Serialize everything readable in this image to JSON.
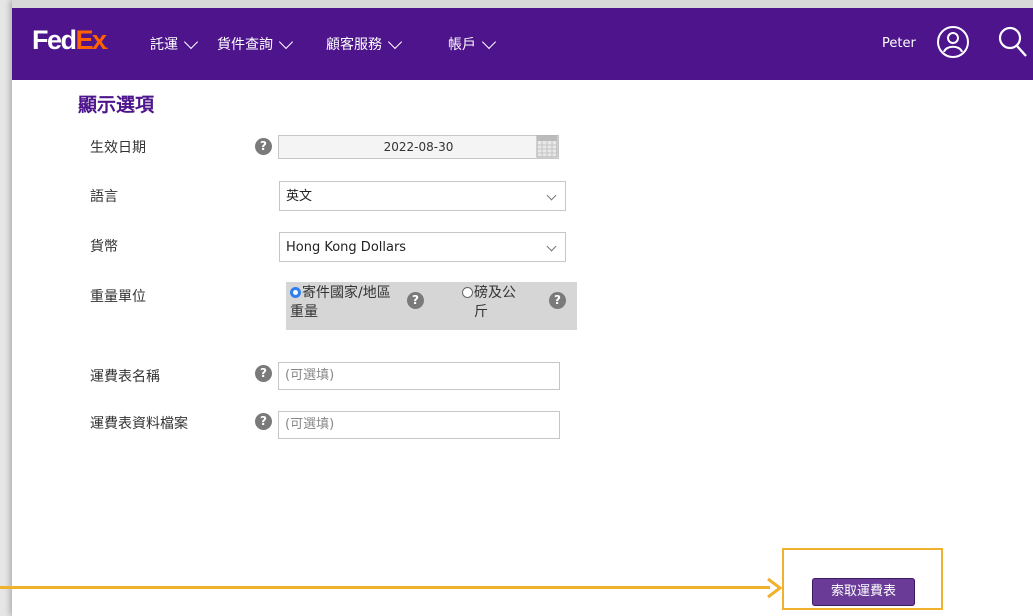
{
  "header": {
    "logo_fed": "Fed",
    "logo_ex": "Ex",
    "logo_dot": ".",
    "nav": [
      {
        "label": "託運"
      },
      {
        "label": "貨件查詢"
      },
      {
        "label": "顧客服務"
      },
      {
        "label": "帳戶"
      }
    ],
    "user_name": "Peter",
    "brand_color": "#4d148c",
    "accent_color": "#ff6200"
  },
  "form": {
    "title": "顯示選項",
    "effective_date": {
      "label": "生效日期",
      "value": "2022-08-30"
    },
    "language": {
      "label": "語言",
      "value": "英文"
    },
    "currency": {
      "label": "貨幣",
      "value": "Hong Kong Dollars"
    },
    "weight_unit": {
      "label": "重量單位",
      "option1_line1": "寄件國家/地區",
      "option1_line2": "重量",
      "option2_line1": "磅及公",
      "option2_line2": "斤",
      "selected": "寄件國家/地區重量"
    },
    "rate_sheet_name": {
      "label": "運費表名稱",
      "placeholder": "(可選填)"
    },
    "rate_sheet_file": {
      "label": "運費表資料檔案",
      "placeholder": "(可選填)"
    },
    "help_glyph": "?",
    "submit_label": "索取運費表"
  },
  "annotation": {
    "highlight_color": "#f2b12c"
  }
}
